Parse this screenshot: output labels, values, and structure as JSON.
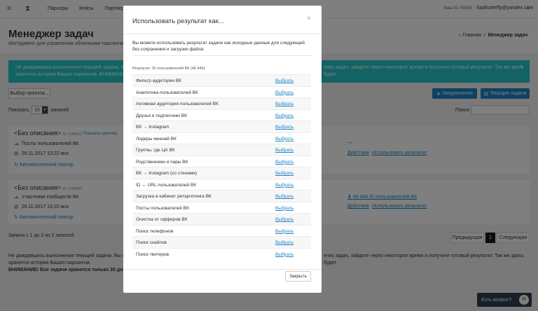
{
  "topbar": {
    "nav": [
      "Парсеры",
      "Кейсы",
      "Партнерка"
    ],
    "user_id": "Ваш ID: 89536",
    "user_email": "SarButterfly@yandex.com"
  },
  "heading": {
    "title": "Менеджер задач",
    "subtitle": "Инструмент для управления облачными парсингами",
    "breadcrumb_home": "Главная",
    "breadcrumb_current": "Менеджер задач"
  },
  "alert": {
    "line1": "Не дождавшись выполнения текущей задачи, Вы мож",
    "line2": "хранится история Ваших парсингов. ВНИМАНИЕ! Вс",
    "right": "очек задач, зайдите через некоторое время и получите готовый результат. Так же здесь будет"
  },
  "toolbar": {
    "project_button": "Выбор проекта...",
    "notify_button": "Уведомления",
    "current_tasks_button": "Текущие задачи",
    "show_label": "Показать",
    "entries_count": "10",
    "entries_label": "записей",
    "search_label": "Поиск:"
  },
  "tasks": [
    {
      "title": "<Без описания>",
      "id": "ID: 1084811",
      "link": "Показать цепочку",
      "type": "Посты пользователей ВК",
      "date": "29.11.2017 13:22 мск",
      "auto": "Автоматический повтор",
      "count": "---",
      "actions": "Действия",
      "use_result": "Использовать результат"
    },
    {
      "title": "<Без описания>",
      "id": "ID: 1084699",
      "type": "Участники сообществ ВК",
      "date": "29.11.2017 13:20 мск",
      "auto": "Автоматический повтор",
      "count": "46 446 ID пользователей ВК",
      "actions": "Действия",
      "use_result": "Использовать результат"
    }
  ],
  "footer": {
    "info": "Записи с 1 до 2 из 2 записей",
    "prev": "Предыдущая",
    "page": "1",
    "next": "Следующая",
    "bottom_left_1": "Не дождавшись выполнения текущей задачи, Вы може",
    "bottom_left_2": "хранится история Ваших парсингов.",
    "bottom_left_3": "ВНИМАНИЕ! Все задачи хранятся только 30 дней с м",
    "bottom_right": "ечек задач, зайдите через некоторое время и получите готовый результат. Так же здесь будет",
    "help": "Есть вопрос?"
  },
  "modal": {
    "title": "Использовать результат как...",
    "close_symbol": "×",
    "description": "Вы можете использовать результат задачи как исходные данные для следующей без сохранения и загрузки файла",
    "result_label": "Результат: ID пользователей ВК (46 446)",
    "select_label": "Выбрать",
    "options": [
      "Фильтр аудитории ВК",
      "Аналитика пользователей ВК",
      "Активная аудитория пользователей ВК",
      "Друзья и подписчики ВК",
      "ВК → Instagram",
      "Лидеры мнений ВК",
      "Группы, где ЦА ВК",
      "Родственники и пары ВК",
      "ВК → Instagram (со стенами)",
      "ID ↔ URL пользователей ВК",
      "Загрузка в кабинет ретаргетинга ВК",
      "Посты пользователей ВК",
      "Очистка от офферов ВК",
      "Поиск телефонов",
      "Поиск скайпов",
      "Поиск твитеров"
    ],
    "close_button": "Закрыть"
  }
}
